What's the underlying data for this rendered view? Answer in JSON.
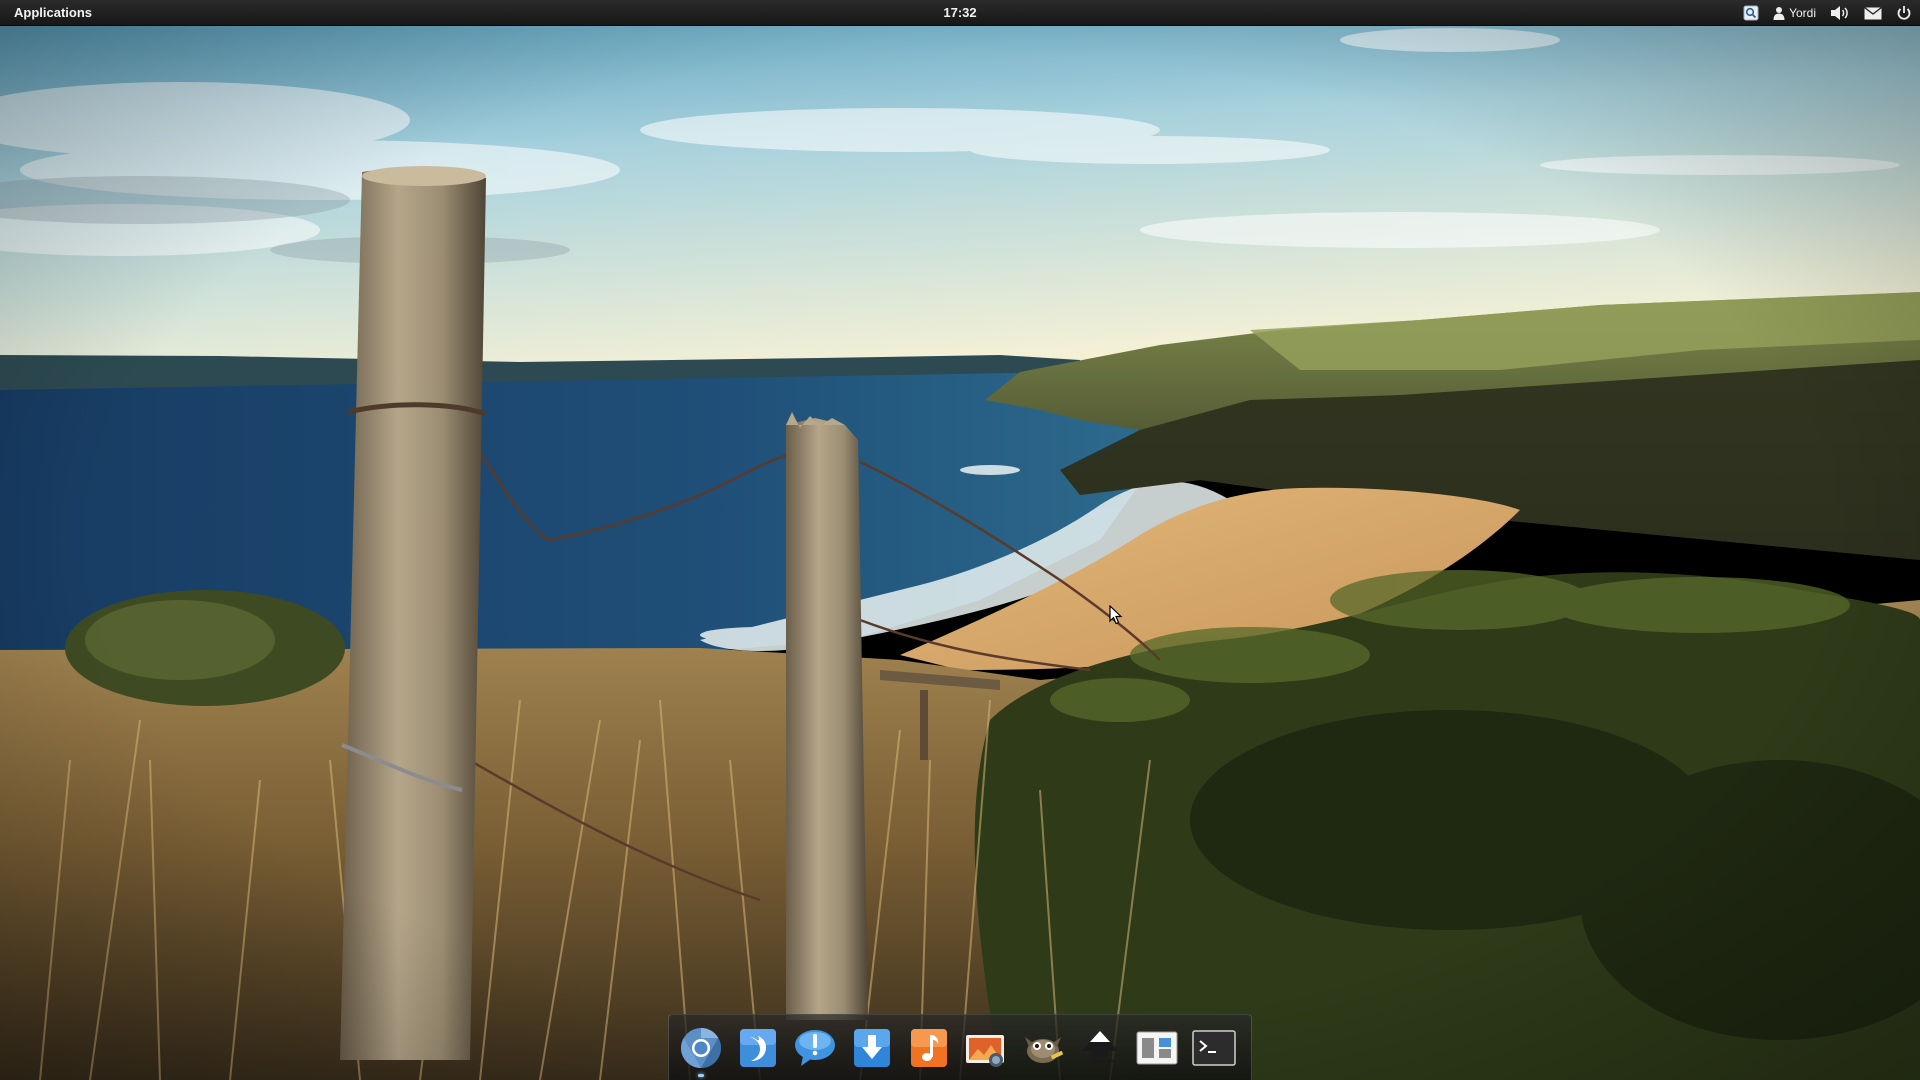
{
  "top_panel": {
    "applications_label": "Applications",
    "clock": "17:32",
    "indicators": {
      "search_icon": "search-icon",
      "user_name": "Yordi",
      "user_icon": "user-icon",
      "sound_icon": "volume-icon",
      "mail_icon": "mail-icon",
      "power_icon": "power-icon"
    }
  },
  "wallpaper": {
    "subject": "coastal-landscape",
    "colors": {
      "sky_top": "#6fb0c4",
      "sky_bottom": "#f4f0d6",
      "sea": "#1f4a73",
      "sand": "#d9aa6c",
      "grass": "#9a7a46"
    }
  },
  "dock": {
    "items": [
      {
        "name": "chromium-browser",
        "icon": "chromium-icon",
        "running": true
      },
      {
        "name": "twitter-client",
        "icon": "bird-icon",
        "running": false
      },
      {
        "name": "messages",
        "icon": "chat-bubble-icon",
        "running": false
      },
      {
        "name": "downloads",
        "icon": "download-arrow-icon",
        "running": false
      },
      {
        "name": "music-player",
        "icon": "music-note-icon",
        "running": false
      },
      {
        "name": "photo-viewer",
        "icon": "photo-icon",
        "running": false
      },
      {
        "name": "gimp",
        "icon": "gimp-icon",
        "running": false
      },
      {
        "name": "inkscape",
        "icon": "inkscape-icon",
        "running": false
      },
      {
        "name": "workspace-switcher",
        "icon": "workspaces-icon",
        "running": false
      },
      {
        "name": "terminal",
        "icon": "terminal-icon",
        "running": false
      }
    ]
  }
}
